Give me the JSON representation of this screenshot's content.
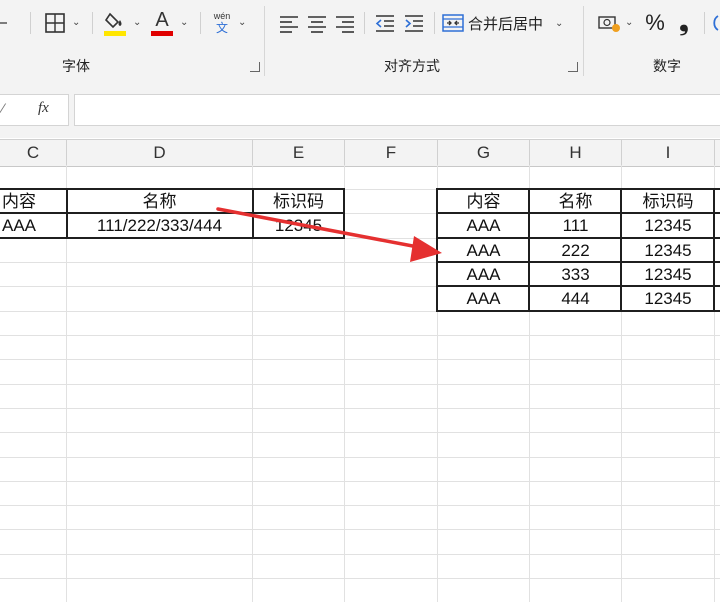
{
  "ribbon": {
    "groups": {
      "font": "字体",
      "alignment": "对齐方式",
      "number": "数字"
    },
    "font_color_letter": "A",
    "phonetic_pinyin": "wén",
    "phonetic_char": "文",
    "merge_center_label": "合并后居中",
    "percent_symbol": "%",
    "comma_symbol": "❟",
    "colors": {
      "fill_color": "#ffe600",
      "font_color": "#e00000",
      "accent_blue": "#2e6fd6"
    }
  },
  "formula_bar": {
    "fx_label": "fx",
    "cell_ref_partial": "⁄",
    "value": ""
  },
  "columns": [
    "C",
    "D",
    "E",
    "F",
    "G",
    "H",
    "I"
  ],
  "source_table": {
    "headers": [
      "内容",
      "名称",
      "标识码"
    ],
    "rows": [
      [
        "AAA",
        "111/222/333/444",
        "12345"
      ]
    ]
  },
  "result_table": {
    "headers": [
      "内容",
      "名称",
      "标识码"
    ],
    "rows": [
      [
        "AAA",
        "111",
        "12345"
      ],
      [
        "AAA",
        "222",
        "12345"
      ],
      [
        "AAA",
        "333",
        "12345"
      ],
      [
        "AAA",
        "444",
        "12345"
      ]
    ]
  },
  "annotation_arrow_color": "#e53030"
}
